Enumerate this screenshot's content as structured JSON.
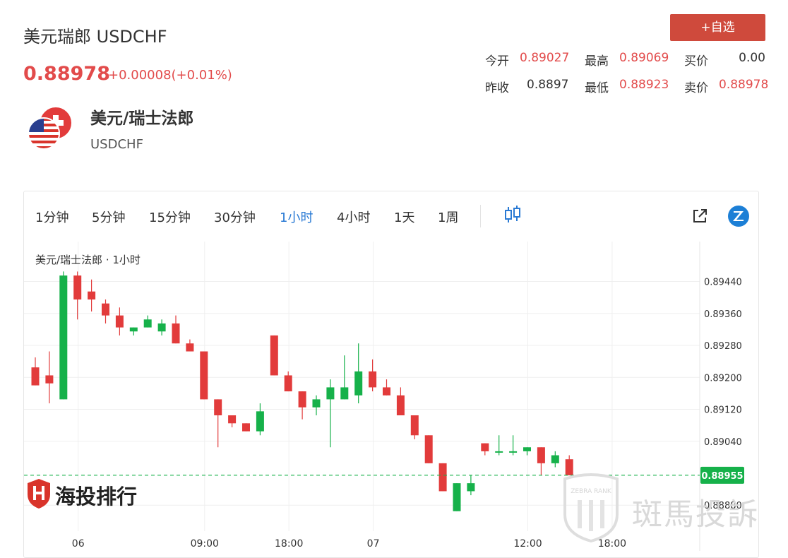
{
  "header": {
    "title": "美元瑞郎 USDCHF",
    "price": "0.88978",
    "change": "+0.00008(+0.01%)",
    "add_button": "+自选"
  },
  "quotes": [
    {
      "label": "今开",
      "value": "0.89027",
      "color": "red"
    },
    {
      "label": "最高",
      "value": "0.89069",
      "color": "red"
    },
    {
      "label": "买价",
      "value": "0.00",
      "color": "dark"
    },
    {
      "label": "昨收",
      "value": "0.8897",
      "color": "dark"
    },
    {
      "label": "最低",
      "value": "0.88923",
      "color": "red"
    },
    {
      "label": "卖价",
      "value": "0.88978",
      "color": "red"
    }
  ],
  "pair": {
    "name": "美元/瑞士法郎",
    "code": "USDCHF"
  },
  "timeframes": [
    "1分钟",
    "5分钟",
    "15分钟",
    "30分钟",
    "1小时",
    "4小时",
    "1天",
    "1周"
  ],
  "active_timeframe": "1小时",
  "icons": [
    "candlestick-icon",
    "external-link-icon",
    "zebra-logo-icon"
  ],
  "brand": {
    "name": "海投排行",
    "watermark": "斑馬投訴",
    "watermark_badge": "ZEBRA RANK"
  },
  "colors": {
    "up": "#16b14a",
    "down": "#e23b3b",
    "accent": "#2a7ad4",
    "button": "#cf4a3c"
  },
  "chart_data": {
    "type": "candlestick",
    "legend": "美元/瑞士法郎 · 1小时",
    "y_ticks": [
      "0.89440",
      "0.89360",
      "0.89280",
      "0.89200",
      "0.89120",
      "0.89040",
      "0.88880"
    ],
    "y_tick_values": [
      0.8944,
      0.8936,
      0.8928,
      0.892,
      0.8912,
      0.8904,
      0.8888
    ],
    "ylim": [
      0.88815,
      0.8954
    ],
    "x_ticks": [
      {
        "label": "06",
        "index": 3
      },
      {
        "label": "09:00",
        "index": 12
      },
      {
        "label": "18:00",
        "index": 18
      },
      {
        "label": "07",
        "index": 24
      },
      {
        "label": "12:00",
        "index": 35
      },
      {
        "label": "18:00",
        "index": 41
      }
    ],
    "current_price": 0.88955,
    "current_price_label": "0.88955",
    "grid": true,
    "candles": [
      {
        "o": 0.89225,
        "h": 0.8925,
        "l": 0.8918,
        "c": 0.8918
      },
      {
        "o": 0.89205,
        "h": 0.89265,
        "l": 0.89135,
        "c": 0.89185
      },
      {
        "o": 0.89145,
        "h": 0.89465,
        "l": 0.89145,
        "c": 0.89455
      },
      {
        "o": 0.89455,
        "h": 0.89465,
        "l": 0.89345,
        "c": 0.89395
      },
      {
        "o": 0.89415,
        "h": 0.89445,
        "l": 0.89365,
        "c": 0.89395
      },
      {
        "o": 0.89385,
        "h": 0.89395,
        "l": 0.89335,
        "c": 0.89355
      },
      {
        "o": 0.89355,
        "h": 0.89375,
        "l": 0.89305,
        "c": 0.89325
      },
      {
        "o": 0.89315,
        "h": 0.89325,
        "l": 0.89305,
        "c": 0.89325
      },
      {
        "o": 0.89325,
        "h": 0.89355,
        "l": 0.89325,
        "c": 0.89345
      },
      {
        "o": 0.89315,
        "h": 0.89345,
        "l": 0.89305,
        "c": 0.89335
      },
      {
        "o": 0.89335,
        "h": 0.89355,
        "l": 0.89285,
        "c": 0.89285
      },
      {
        "o": 0.89285,
        "h": 0.89295,
        "l": 0.89265,
        "c": 0.89265
      },
      {
        "o": 0.89265,
        "h": 0.89265,
        "l": 0.89145,
        "c": 0.89145
      },
      {
        "o": 0.89145,
        "h": 0.89145,
        "l": 0.89025,
        "c": 0.89105
      },
      {
        "o": 0.89105,
        "h": 0.89105,
        "l": 0.89075,
        "c": 0.89085
      },
      {
        "o": 0.89085,
        "h": 0.89085,
        "l": 0.89065,
        "c": 0.89065
      },
      {
        "o": 0.89065,
        "h": 0.89135,
        "l": 0.89055,
        "c": 0.89115
      },
      {
        "o": 0.89305,
        "h": 0.89305,
        "l": 0.89205,
        "c": 0.89205
      },
      {
        "o": 0.89205,
        "h": 0.89215,
        "l": 0.89165,
        "c": 0.89165
      },
      {
        "o": 0.89165,
        "h": 0.89165,
        "l": 0.89095,
        "c": 0.89125
      },
      {
        "o": 0.89125,
        "h": 0.89155,
        "l": 0.89105,
        "c": 0.89145
      },
      {
        "o": 0.89145,
        "h": 0.89195,
        "l": 0.89025,
        "c": 0.89175
      },
      {
        "o": 0.89145,
        "h": 0.89255,
        "l": 0.89145,
        "c": 0.89175
      },
      {
        "o": 0.89155,
        "h": 0.89285,
        "l": 0.89135,
        "c": 0.89215
      },
      {
        "o": 0.89215,
        "h": 0.89245,
        "l": 0.89165,
        "c": 0.89175
      },
      {
        "o": 0.89175,
        "h": 0.89195,
        "l": 0.89155,
        "c": 0.89155
      },
      {
        "o": 0.89155,
        "h": 0.89175,
        "l": 0.89105,
        "c": 0.89105
      },
      {
        "o": 0.89105,
        "h": 0.89105,
        "l": 0.89045,
        "c": 0.89055
      },
      {
        "o": 0.89055,
        "h": 0.89055,
        "l": 0.88985,
        "c": 0.88985
      },
      {
        "o": 0.88985,
        "h": 0.88985,
        "l": 0.88915,
        "c": 0.88915
      },
      {
        "o": 0.88865,
        "h": 0.88935,
        "l": 0.88865,
        "c": 0.88935
      },
      {
        "o": 0.88915,
        "h": 0.88955,
        "l": 0.88905,
        "c": 0.88935
      },
      {
        "o": 0.89035,
        "h": 0.89035,
        "l": 0.89005,
        "c": 0.89015
      },
      {
        "o": 0.89015,
        "h": 0.89055,
        "l": 0.89005,
        "c": 0.89015
      },
      {
        "o": 0.89015,
        "h": 0.89055,
        "l": 0.89005,
        "c": 0.89015
      },
      {
        "o": 0.89015,
        "h": 0.89025,
        "l": 0.89005,
        "c": 0.89025
      },
      {
        "o": 0.89025,
        "h": 0.89025,
        "l": 0.88955,
        "c": 0.88985
      },
      {
        "o": 0.88985,
        "h": 0.89015,
        "l": 0.88975,
        "c": 0.89005
      },
      {
        "o": 0.88995,
        "h": 0.89005,
        "l": 0.88955,
        "c": 0.88955
      }
    ]
  }
}
